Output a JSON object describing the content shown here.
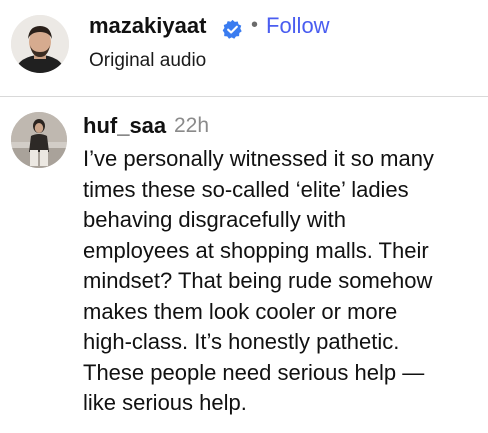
{
  "post": {
    "author": "mazakiyaat",
    "verified_icon": "verified-badge-icon",
    "separator": "•",
    "follow_label": "Follow",
    "audio_label": "Original audio",
    "colors": {
      "follow": "#4a5df0",
      "verified": "#3a7cf0",
      "divider": "#d9d9d9"
    }
  },
  "comment": {
    "username": "huf_saa",
    "time": "22h",
    "lines": [
      "I’ve personally witnessed it so many",
      "times these so-called ‘elite’ ladies",
      "behaving disgracefully with",
      "employees at shopping malls. Their",
      "mindset? That being rude somehow",
      "makes them look cooler or more",
      "high-class. It’s honestly pathetic.",
      "These people need serious help —",
      "like serious help."
    ]
  }
}
